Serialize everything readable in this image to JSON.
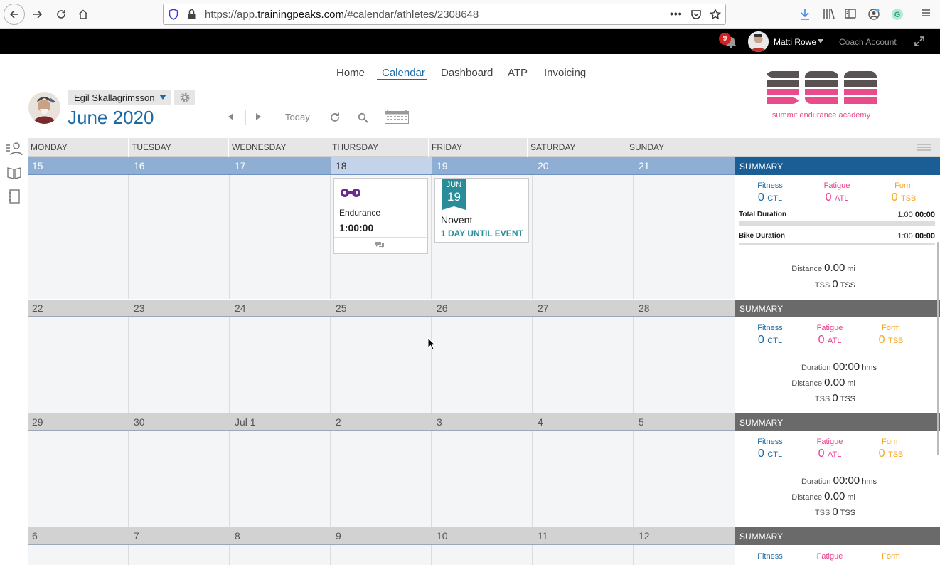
{
  "browser": {
    "url_prefix": "https://app.",
    "url_domain": "trainingpeaks.com",
    "url_suffix": "/#calendar/athletes/2308648"
  },
  "topbar": {
    "notifications_count": "9",
    "user_name": "Matti Rowe",
    "account_type": "Coach Account"
  },
  "nav": {
    "items": [
      "Home",
      "Calendar",
      "Dashboard",
      "ATP",
      "Invoicing"
    ],
    "active": "Calendar"
  },
  "header": {
    "athlete_name": "Egil Skallagrimsson",
    "month_title": "June 2020",
    "today_label": "Today"
  },
  "logo": {
    "text": "summit endurance academy",
    "colors": {
      "gray": "#5a5153",
      "pink": "#e84c8b"
    }
  },
  "calendar": {
    "days_of_week": [
      "MONDAY",
      "TUESDAY",
      "WEDNESDAY",
      "THURSDAY",
      "FRIDAY",
      "SATURDAY",
      "SUNDAY"
    ],
    "weeks": [
      {
        "dates": [
          "15",
          "16",
          "17",
          "18",
          "19",
          "20",
          "21"
        ],
        "today_index": 3
      },
      {
        "dates": [
          "22",
          "23",
          "24",
          "25",
          "26",
          "27",
          "28"
        ]
      },
      {
        "dates": [
          "29",
          "30",
          "Jul 1",
          "2",
          "3",
          "4",
          "5"
        ]
      },
      {
        "dates": [
          "6",
          "7",
          "8",
          "9",
          "10",
          "11",
          "12"
        ]
      }
    ],
    "workout": {
      "title": "Endurance",
      "duration": "1:00:00",
      "sport_icon": "bike-icon"
    },
    "event": {
      "month": "JUN",
      "day": "19",
      "name": "Novent",
      "countdown": "1 DAY UNTIL EVENT"
    }
  },
  "summary": {
    "header_label": "SUMMARY",
    "fitness_label": "Fitness",
    "fatigue_label": "Fatigue",
    "form_label": "Form",
    "ctl_value": "0",
    "ctl_unit": "CTL",
    "atl_value": "0",
    "atl_unit": "ATL",
    "tsb_value": "0",
    "tsb_unit": "TSB",
    "week1": {
      "total_duration_label": "Total Duration",
      "total_duration_planned": "1:00",
      "total_duration_completed": "00:00",
      "bike_duration_label": "Bike Duration",
      "bike_duration_planned": "1:00",
      "bike_duration_completed": "00:00"
    },
    "duration_label": "Duration",
    "duration_value": "00:00",
    "duration_unit": "hms",
    "distance_label": "Distance",
    "distance_value": "0.00",
    "distance_unit": "mi",
    "tss_label": "TSS",
    "tss_value": "0",
    "tss_unit": "TSS",
    "colors": {
      "fitness": "#1b6aa5",
      "fatigue": "#e83e8c",
      "form": "#f5a623",
      "current_header": "#1b5e95",
      "other_header": "#6a6a6a"
    }
  }
}
